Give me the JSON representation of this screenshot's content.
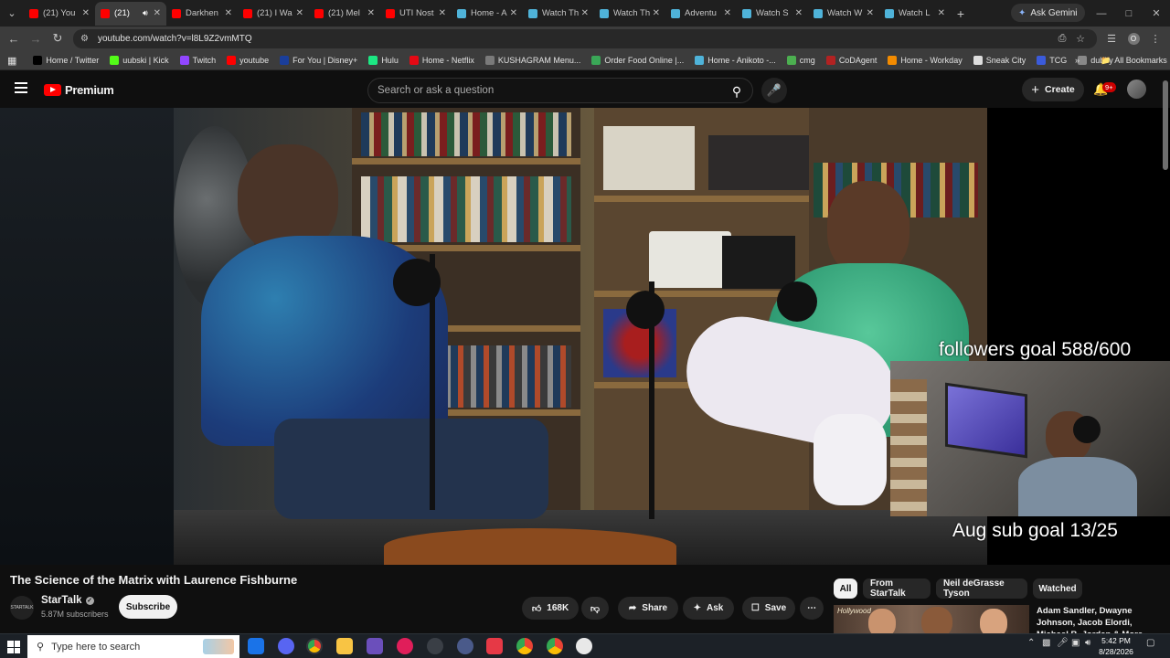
{
  "browser": {
    "tabs": [
      {
        "title": "(21) You",
        "color": "#ff0000",
        "active": false
      },
      {
        "title": "(21) ",
        "color": "#ff0000",
        "active": true
      },
      {
        "title": "Darkhen",
        "color": "#ff0000",
        "active": false
      },
      {
        "title": "(21) I Wa",
        "color": "#ff0000",
        "active": false
      },
      {
        "title": "(21) Mel",
        "color": "#ff0000",
        "active": false
      },
      {
        "title": "UTI Nost",
        "color": "#ff0000",
        "active": false
      },
      {
        "title": "Home - A",
        "color": "#4fb3d9",
        "active": false
      },
      {
        "title": "Watch Th",
        "color": "#4fb3d9",
        "active": false
      },
      {
        "title": "Watch Th",
        "color": "#4fb3d9",
        "active": false
      },
      {
        "title": "Adventu",
        "color": "#4fb3d9",
        "active": false
      },
      {
        "title": "Watch S",
        "color": "#4fb3d9",
        "active": false
      },
      {
        "title": "Watch W",
        "color": "#4fb3d9",
        "active": false
      },
      {
        "title": "Watch L",
        "color": "#4fb3d9",
        "active": false
      }
    ],
    "gemini_label": "Ask Gemini",
    "url": "youtube.com/watch?v=l8L9Z2vmMTQ",
    "profile_initial": "O",
    "bookmarks": [
      {
        "label": "Home / Twitter",
        "color": "#000000"
      },
      {
        "label": "uubski | Kick",
        "color": "#53fc18"
      },
      {
        "label": "Twitch",
        "color": "#9146ff"
      },
      {
        "label": "youtube",
        "color": "#ff0000"
      },
      {
        "label": "For You | Disney+",
        "color": "#1a3e9b"
      },
      {
        "label": "Hulu",
        "color": "#1ce783"
      },
      {
        "label": "Home - Netflix",
        "color": "#e50914"
      },
      {
        "label": "KUSHAGRAM Menu...",
        "color": "#7a7a7a"
      },
      {
        "label": "Order Food Online |...",
        "color": "#3aa757"
      },
      {
        "label": "Home - Anikoto -...",
        "color": "#4fb3d9"
      },
      {
        "label": "cmg",
        "color": "#4caf50"
      },
      {
        "label": "CoDAgent",
        "color": "#b22222"
      },
      {
        "label": "Home - Workday",
        "color": "#f38b00"
      },
      {
        "label": "Sneak City",
        "color": "#dddddd"
      },
      {
        "label": "TCG",
        "color": "#3b5bdb"
      },
      {
        "label": "dubby",
        "color": "#888888"
      }
    ],
    "all_bookmarks_label": "All Bookmarks"
  },
  "youtube": {
    "logo_text": "Premium",
    "search_placeholder": "Search or ask a question",
    "create_label": "Create",
    "notif_badge": "9+"
  },
  "stream_overlay": {
    "followers_goal": "followers goal 588/600",
    "sub_goal": "Aug sub goal 13/25"
  },
  "video": {
    "title": "The Science of the Matrix with Laurence Fishburne",
    "channel": "StarTalk",
    "channel_avatar_text": "STARTALK",
    "subscribers": "5.87M subscribers",
    "subscribe_label": "Subscribe",
    "likes": "168K",
    "share_label": "Share",
    "ask_label": "Ask",
    "save_label": "Save"
  },
  "sidebar": {
    "chips": [
      "All",
      "From StarTalk",
      "Neil deGrasse Tyson",
      "Watched"
    ],
    "recommendation_title": "Adam Sandler, Dwayne Johnson, Jacob Elordi, Michael B. Jordan & More",
    "thumb_caption": "Hollywood"
  },
  "taskbar": {
    "search_placeholder": "Type here to search",
    "time": "5:42 PM",
    "date": "8/28/2026"
  }
}
